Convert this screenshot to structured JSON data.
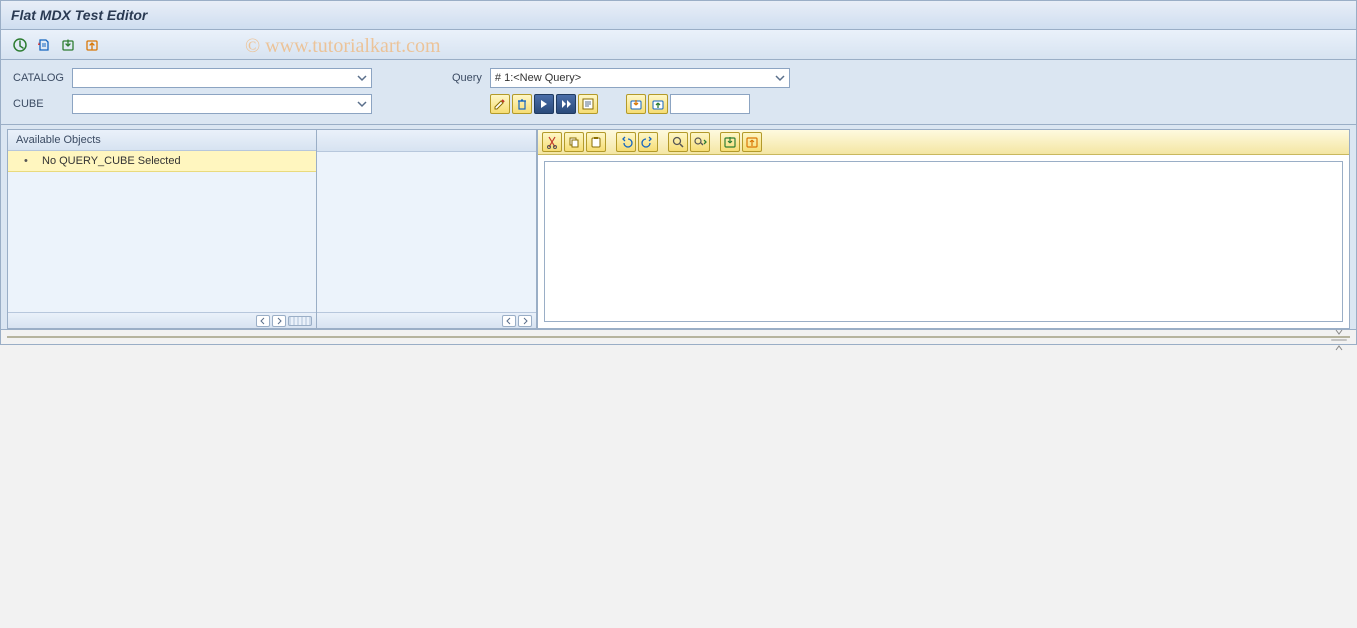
{
  "title": "Flat MDX Test Editor",
  "main_toolbar": {
    "items": [
      "execute",
      "history",
      "import",
      "export"
    ]
  },
  "selection": {
    "catalog_label": "CATALOG",
    "catalog_value": "",
    "cube_label": "CUBE",
    "cube_value": "",
    "query_label": "Query",
    "query_value": "#  1:<New Query>",
    "query_toolbar": [
      "edit",
      "delete",
      "execute-step",
      "fast-forward",
      "show-text"
    ],
    "query_toolbar_right": [
      "load",
      "save"
    ]
  },
  "objects_panel": {
    "header": "Available Objects",
    "items": [
      "No QUERY_CUBE Selected"
    ]
  },
  "editor_toolbar": {
    "items": [
      "cut",
      "copy",
      "paste",
      "undo",
      "redo",
      "find",
      "find-next",
      "import",
      "export"
    ]
  },
  "watermark": "© www.tutorialkart.com"
}
